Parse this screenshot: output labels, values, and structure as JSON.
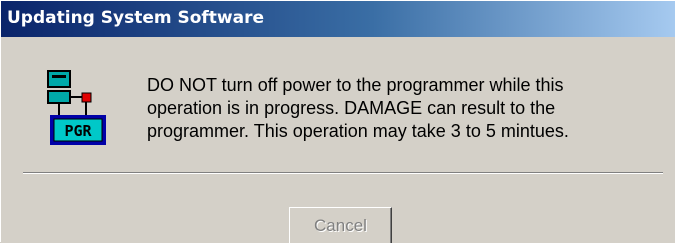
{
  "window": {
    "title": "Updating System Software"
  },
  "icon": {
    "name": "programmer-icon",
    "label": "PGR"
  },
  "message": {
    "lines": [
      "DO NOT turn off power to the programmer while this",
      "operation is in progress. DAMAGE can result to the",
      "programmer. This operation may take 3 to 5 mintues."
    ]
  },
  "buttons": {
    "cancel": {
      "label": "Cancel",
      "state": "disabled"
    }
  },
  "colors": {
    "titlebar_start": "#0a246a",
    "titlebar_end": "#a6caf0",
    "dialog_background": "#d4d0c8",
    "disabled_text": "#808080"
  }
}
